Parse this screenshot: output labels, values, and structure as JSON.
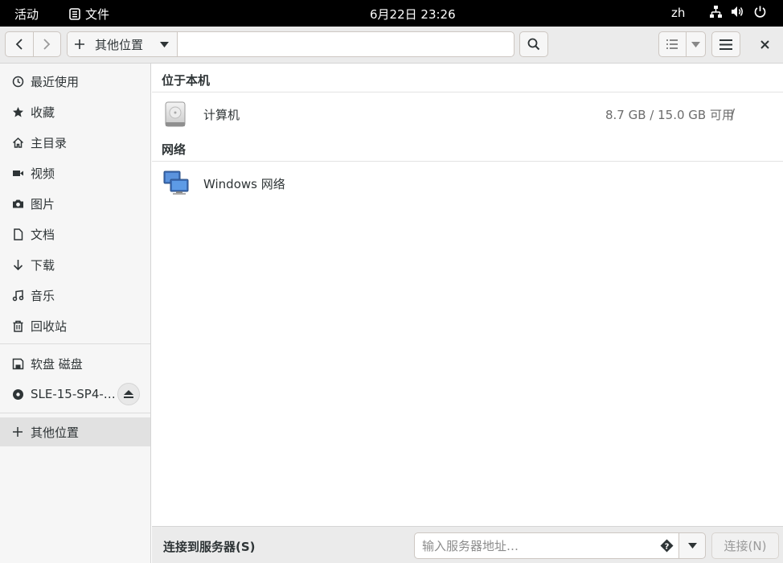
{
  "topbar": {
    "activities": "活动",
    "app_name": "文件",
    "clock": "6月22日 23:26",
    "language": "zh"
  },
  "header": {
    "location_label": "其他位置"
  },
  "sidebar": {
    "items": [
      {
        "label": "最近使用",
        "icon": "clock-icon"
      },
      {
        "label": "收藏",
        "icon": "star-icon"
      },
      {
        "label": "主目录",
        "icon": "home-icon"
      },
      {
        "label": "视频",
        "icon": "video-icon"
      },
      {
        "label": "图片",
        "icon": "camera-icon"
      },
      {
        "label": "文档",
        "icon": "document-icon"
      },
      {
        "label": "下载",
        "icon": "download-icon"
      },
      {
        "label": "音乐",
        "icon": "music-icon"
      },
      {
        "label": "回收站",
        "icon": "trash-icon"
      }
    ],
    "devices": [
      {
        "label": "软盘 磁盘",
        "icon": "floppy-icon"
      },
      {
        "label": "SLE-15-SP4-…",
        "icon": "disc-icon"
      }
    ],
    "other": {
      "label": "其他位置",
      "icon": "plus-icon"
    }
  },
  "main": {
    "local_section": "位于本机",
    "network_section": "网络",
    "computer": {
      "name": "计算机",
      "space": "8.7 GB / 15.0 GB 可用",
      "mount": "/"
    },
    "network_item": {
      "name": "Windows 网络"
    }
  },
  "bottom": {
    "connect_label": "连接到服务器(S)",
    "server_placeholder": "输入服务器地址…",
    "connect_button": "连接(N)"
  }
}
